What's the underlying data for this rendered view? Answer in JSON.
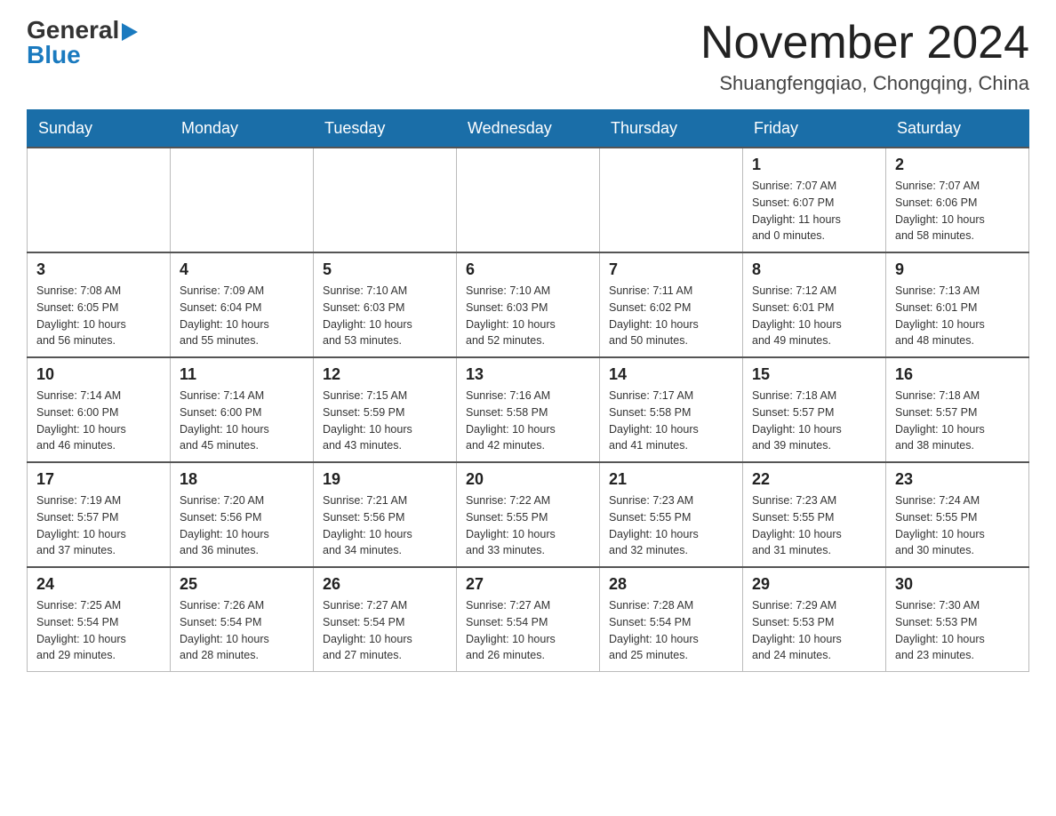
{
  "header": {
    "logo_general": "General",
    "logo_blue": "Blue",
    "main_title": "November 2024",
    "subtitle": "Shuangfengqiao, Chongqing, China"
  },
  "weekdays": [
    "Sunday",
    "Monday",
    "Tuesday",
    "Wednesday",
    "Thursday",
    "Friday",
    "Saturday"
  ],
  "weeks": [
    [
      {
        "day": "",
        "info": ""
      },
      {
        "day": "",
        "info": ""
      },
      {
        "day": "",
        "info": ""
      },
      {
        "day": "",
        "info": ""
      },
      {
        "day": "",
        "info": ""
      },
      {
        "day": "1",
        "info": "Sunrise: 7:07 AM\nSunset: 6:07 PM\nDaylight: 11 hours\nand 0 minutes."
      },
      {
        "day": "2",
        "info": "Sunrise: 7:07 AM\nSunset: 6:06 PM\nDaylight: 10 hours\nand 58 minutes."
      }
    ],
    [
      {
        "day": "3",
        "info": "Sunrise: 7:08 AM\nSunset: 6:05 PM\nDaylight: 10 hours\nand 56 minutes."
      },
      {
        "day": "4",
        "info": "Sunrise: 7:09 AM\nSunset: 6:04 PM\nDaylight: 10 hours\nand 55 minutes."
      },
      {
        "day": "5",
        "info": "Sunrise: 7:10 AM\nSunset: 6:03 PM\nDaylight: 10 hours\nand 53 minutes."
      },
      {
        "day": "6",
        "info": "Sunrise: 7:10 AM\nSunset: 6:03 PM\nDaylight: 10 hours\nand 52 minutes."
      },
      {
        "day": "7",
        "info": "Sunrise: 7:11 AM\nSunset: 6:02 PM\nDaylight: 10 hours\nand 50 minutes."
      },
      {
        "day": "8",
        "info": "Sunrise: 7:12 AM\nSunset: 6:01 PM\nDaylight: 10 hours\nand 49 minutes."
      },
      {
        "day": "9",
        "info": "Sunrise: 7:13 AM\nSunset: 6:01 PM\nDaylight: 10 hours\nand 48 minutes."
      }
    ],
    [
      {
        "day": "10",
        "info": "Sunrise: 7:14 AM\nSunset: 6:00 PM\nDaylight: 10 hours\nand 46 minutes."
      },
      {
        "day": "11",
        "info": "Sunrise: 7:14 AM\nSunset: 6:00 PM\nDaylight: 10 hours\nand 45 minutes."
      },
      {
        "day": "12",
        "info": "Sunrise: 7:15 AM\nSunset: 5:59 PM\nDaylight: 10 hours\nand 43 minutes."
      },
      {
        "day": "13",
        "info": "Sunrise: 7:16 AM\nSunset: 5:58 PM\nDaylight: 10 hours\nand 42 minutes."
      },
      {
        "day": "14",
        "info": "Sunrise: 7:17 AM\nSunset: 5:58 PM\nDaylight: 10 hours\nand 41 minutes."
      },
      {
        "day": "15",
        "info": "Sunrise: 7:18 AM\nSunset: 5:57 PM\nDaylight: 10 hours\nand 39 minutes."
      },
      {
        "day": "16",
        "info": "Sunrise: 7:18 AM\nSunset: 5:57 PM\nDaylight: 10 hours\nand 38 minutes."
      }
    ],
    [
      {
        "day": "17",
        "info": "Sunrise: 7:19 AM\nSunset: 5:57 PM\nDaylight: 10 hours\nand 37 minutes."
      },
      {
        "day": "18",
        "info": "Sunrise: 7:20 AM\nSunset: 5:56 PM\nDaylight: 10 hours\nand 36 minutes."
      },
      {
        "day": "19",
        "info": "Sunrise: 7:21 AM\nSunset: 5:56 PM\nDaylight: 10 hours\nand 34 minutes."
      },
      {
        "day": "20",
        "info": "Sunrise: 7:22 AM\nSunset: 5:55 PM\nDaylight: 10 hours\nand 33 minutes."
      },
      {
        "day": "21",
        "info": "Sunrise: 7:23 AM\nSunset: 5:55 PM\nDaylight: 10 hours\nand 32 minutes."
      },
      {
        "day": "22",
        "info": "Sunrise: 7:23 AM\nSunset: 5:55 PM\nDaylight: 10 hours\nand 31 minutes."
      },
      {
        "day": "23",
        "info": "Sunrise: 7:24 AM\nSunset: 5:55 PM\nDaylight: 10 hours\nand 30 minutes."
      }
    ],
    [
      {
        "day": "24",
        "info": "Sunrise: 7:25 AM\nSunset: 5:54 PM\nDaylight: 10 hours\nand 29 minutes."
      },
      {
        "day": "25",
        "info": "Sunrise: 7:26 AM\nSunset: 5:54 PM\nDaylight: 10 hours\nand 28 minutes."
      },
      {
        "day": "26",
        "info": "Sunrise: 7:27 AM\nSunset: 5:54 PM\nDaylight: 10 hours\nand 27 minutes."
      },
      {
        "day": "27",
        "info": "Sunrise: 7:27 AM\nSunset: 5:54 PM\nDaylight: 10 hours\nand 26 minutes."
      },
      {
        "day": "28",
        "info": "Sunrise: 7:28 AM\nSunset: 5:54 PM\nDaylight: 10 hours\nand 25 minutes."
      },
      {
        "day": "29",
        "info": "Sunrise: 7:29 AM\nSunset: 5:53 PM\nDaylight: 10 hours\nand 24 minutes."
      },
      {
        "day": "30",
        "info": "Sunrise: 7:30 AM\nSunset: 5:53 PM\nDaylight: 10 hours\nand 23 minutes."
      }
    ]
  ]
}
